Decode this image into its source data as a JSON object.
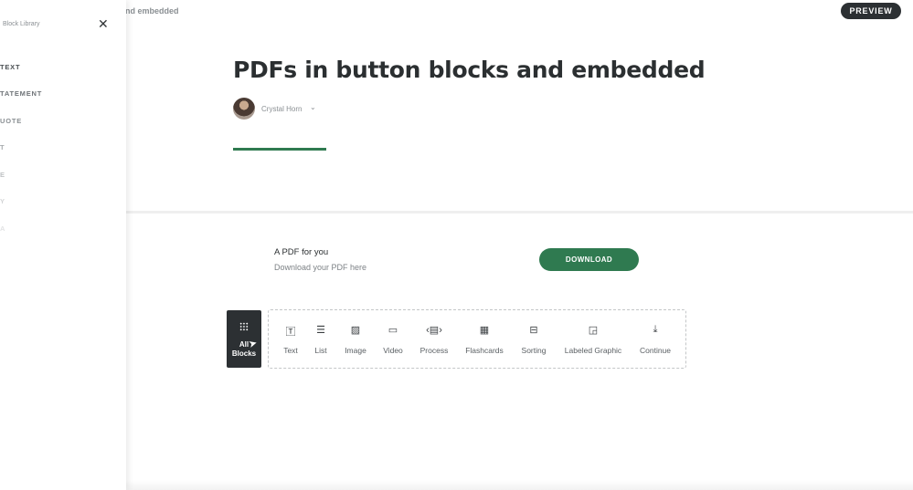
{
  "topbar": {
    "lesson_crumb": "nd embedded",
    "preview_label": "PREVIEW"
  },
  "lesson": {
    "title": "PDFs in button blocks and embedded",
    "author": "Crystal Horn",
    "author_chevron": "⌄"
  },
  "button_block": {
    "title": "A PDF for you",
    "description": "Download your PDF here",
    "button_label": "DOWNLOAD"
  },
  "toolbar": {
    "all_blocks_line1": "All",
    "all_blocks_line2": "Blocks",
    "items": [
      {
        "label": "Text",
        "icon": "text-icon",
        "glyph": "🅃"
      },
      {
        "label": "List",
        "icon": "list-icon",
        "glyph": "☰"
      },
      {
        "label": "Image",
        "icon": "image-icon",
        "glyph": "▨"
      },
      {
        "label": "Video",
        "icon": "video-icon",
        "glyph": "▭"
      },
      {
        "label": "Process",
        "icon": "process-icon",
        "glyph": "‹▤›"
      },
      {
        "label": "Flashcards",
        "icon": "flashcards-icon",
        "glyph": "▦"
      },
      {
        "label": "Sorting",
        "icon": "sorting-icon",
        "glyph": "⊟"
      },
      {
        "label": "Labeled Graphic",
        "icon": "labeled-graphic-icon",
        "glyph": "◲"
      },
      {
        "label": "Continue",
        "icon": "continue-icon",
        "glyph": "⤓"
      }
    ]
  },
  "sidebar": {
    "title": "Block Library",
    "items": [
      {
        "label": "TEXT",
        "color": "#4a4f53"
      },
      {
        "label": "TATEMENT",
        "color": "#6f7478"
      },
      {
        "label": "UOTE",
        "color": "#8a8f93"
      },
      {
        "label": "T",
        "color": "#a6aaad"
      },
      {
        "label": "E",
        "color": "#bfc2c4"
      },
      {
        "label": "Y",
        "color": "#d3d5d7"
      },
      {
        "label": "A",
        "color": "#e2e3e4"
      }
    ]
  },
  "colors": {
    "accent_green": "#2f7a50",
    "dark": "#2c3033"
  }
}
